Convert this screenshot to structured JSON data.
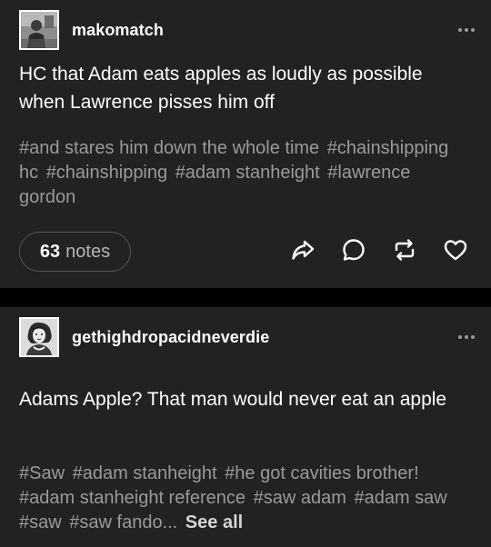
{
  "posts": [
    {
      "username": "makomatch",
      "avatar_icon": "person-photo-avatar",
      "text": "HC that Adam eats apples as loudly as possible when Lawrence pisses him off",
      "tags": [
        "#and stares him down the whole time",
        "#chainshipping hc",
        "#chainshipping",
        "#adam stanheight",
        "#lawrence gordon"
      ],
      "notes_count": "63",
      "notes_label": "notes",
      "actions": [
        "share-icon",
        "reply-icon",
        "reblog-icon",
        "like-icon"
      ]
    },
    {
      "username": "gethighdropacidneverdie",
      "avatar_icon": "vintage-portrait-avatar",
      "text": "Adams Apple? That man would never eat an apple",
      "tags": [
        "#Saw",
        "#adam stanheight",
        "#he got cavities brother!",
        "#adam stanheight reference",
        "#saw adam",
        "#adam saw",
        "#saw",
        "#saw fando..."
      ],
      "see_all": "See all"
    }
  ],
  "colors": {
    "card_bg": "#222222",
    "page_bg": "#000000",
    "tag_color": "#9a9a9a",
    "text": "#ffffff"
  }
}
